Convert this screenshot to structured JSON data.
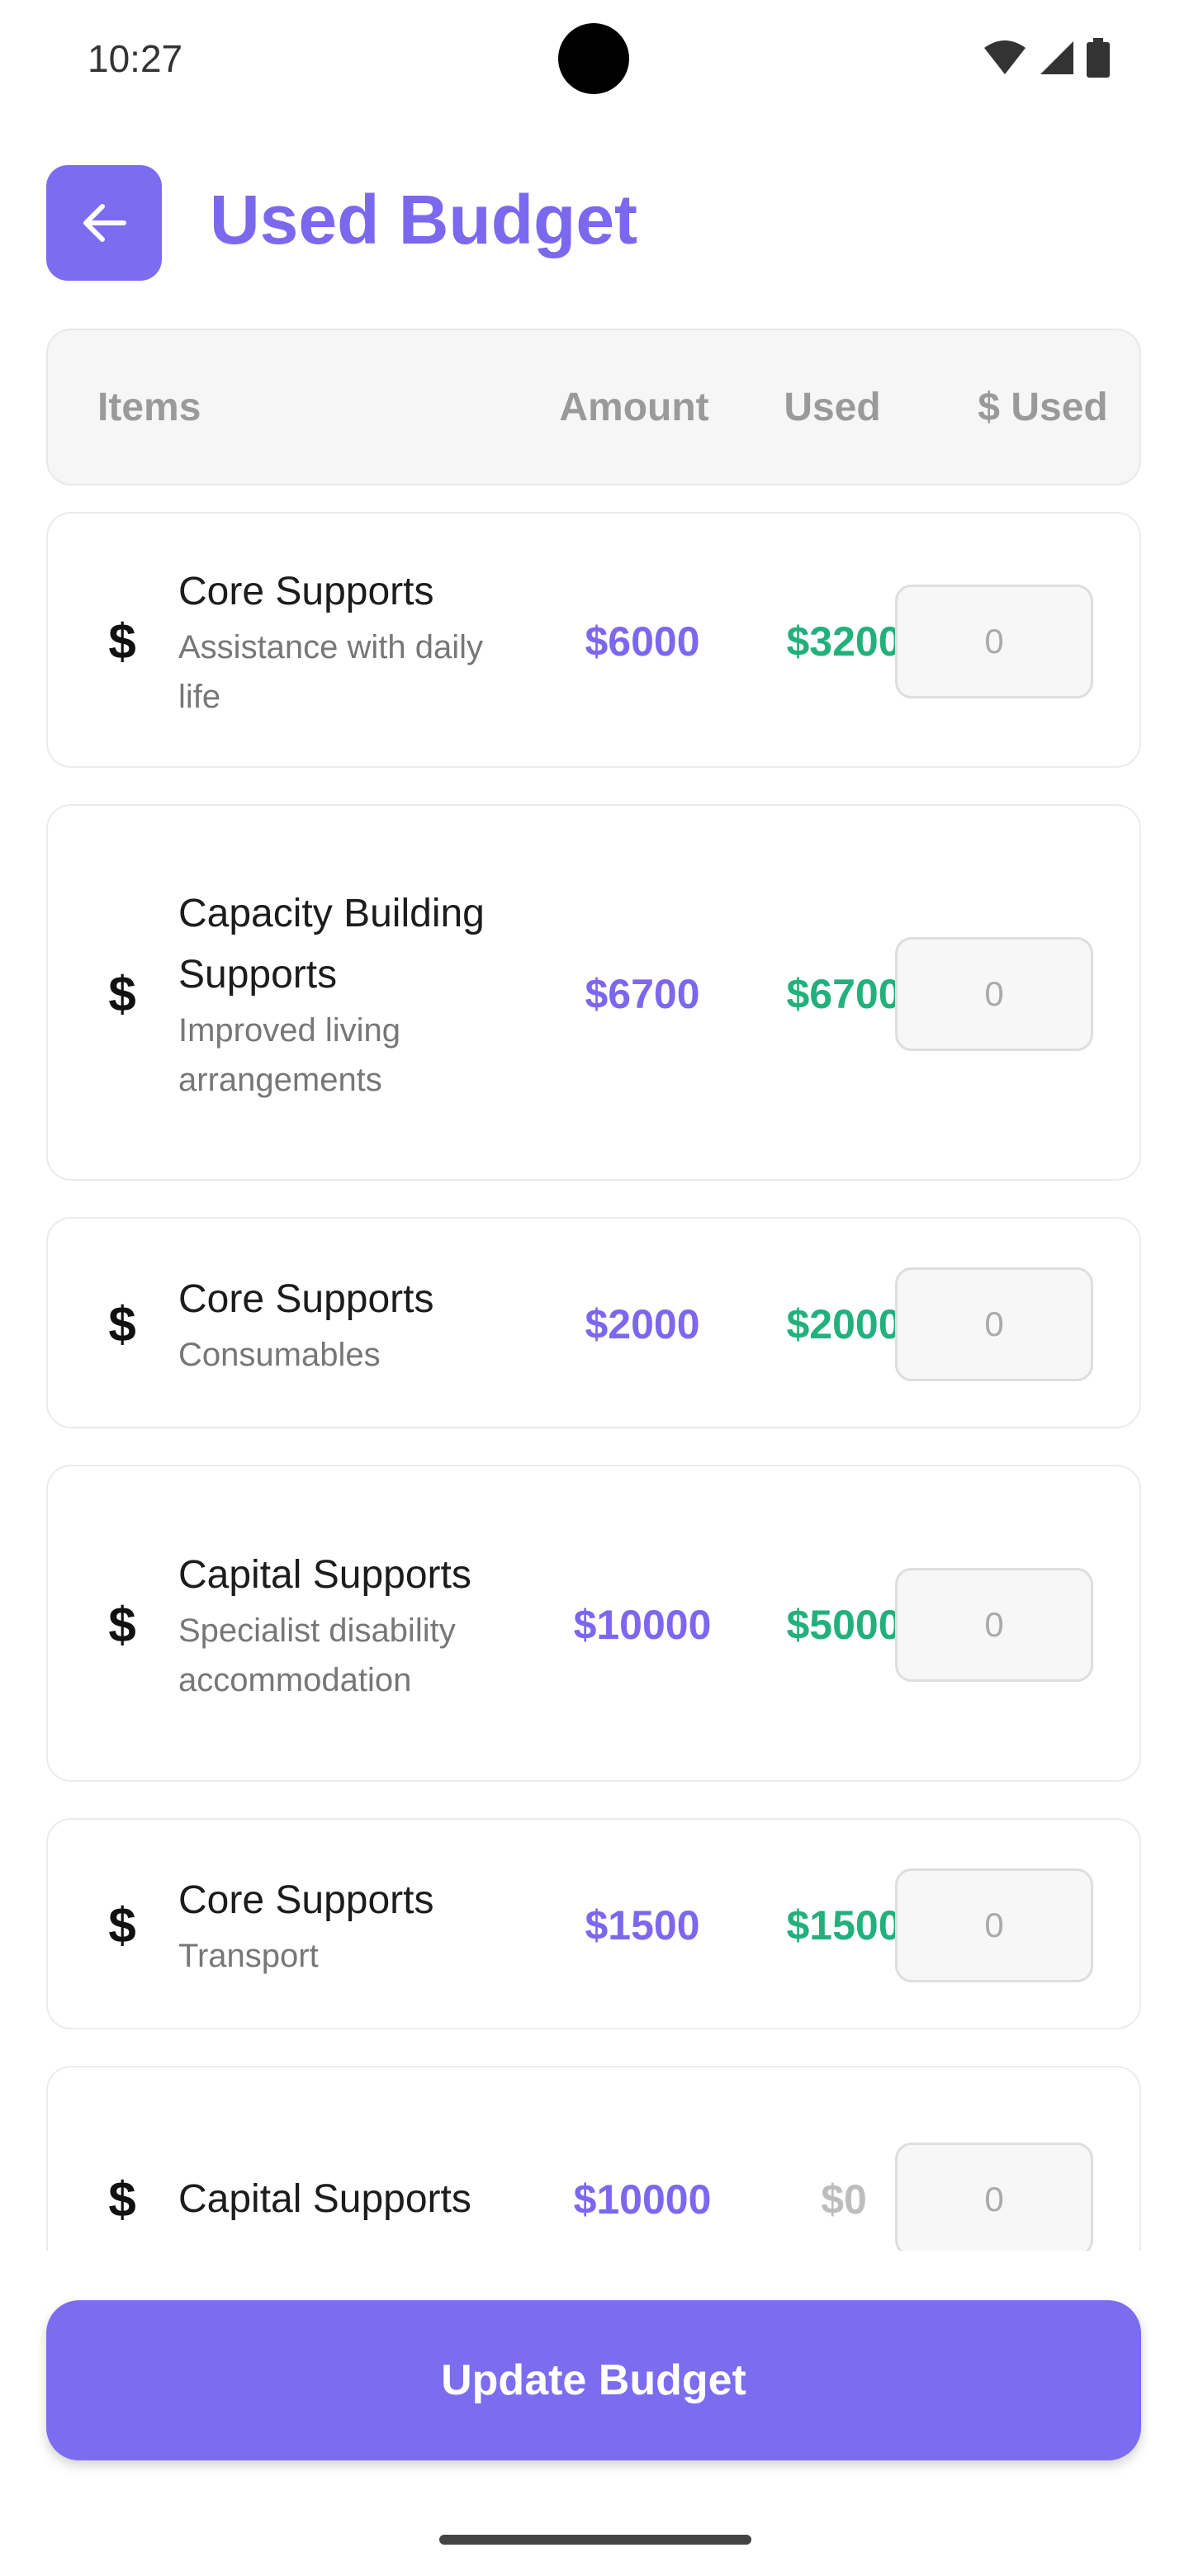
{
  "status_bar": {
    "time": "10:27",
    "icons": [
      "wifi-icon",
      "signal-icon",
      "battery-icon"
    ]
  },
  "header": {
    "back_icon": "arrow-left-icon",
    "title": "Used Budget"
  },
  "table_header": {
    "items": "Items",
    "amount": "Amount",
    "used": "Used",
    "dollar_used": "$ Used"
  },
  "budget_items": [
    {
      "icon": "$",
      "title": "Core Supports",
      "subtitle": "Assistance with daily life",
      "amount": "$6000",
      "used": "$3200",
      "input_placeholder": "0"
    },
    {
      "icon": "$",
      "title": "Capacity Building Supports",
      "subtitle": "Improved living arrangements",
      "amount": "$6700",
      "used": "$6700",
      "input_placeholder": "0"
    },
    {
      "icon": "$",
      "title": "Core Supports",
      "subtitle": "Consumables",
      "amount": "$2000",
      "used": "$2000",
      "input_placeholder": "0"
    },
    {
      "icon": "$",
      "title": "Capital Supports",
      "subtitle": "Specialist disability accommodation",
      "amount": "$10000",
      "used": "$5000",
      "input_placeholder": "0"
    },
    {
      "icon": "$",
      "title": "Core Supports",
      "subtitle": "Transport",
      "amount": "$1500",
      "used": "$1500",
      "input_placeholder": "0"
    },
    {
      "icon": "$",
      "title": "Capital Supports",
      "subtitle": "",
      "amount": "$10000",
      "used": "$0",
      "input_placeholder": "0"
    }
  ],
  "footer": {
    "update_button": "Update Budget"
  },
  "colors": {
    "accent": "#7b68ee",
    "button": "#7b6cf0",
    "used_green": "#22b07d",
    "used_zero": "#bdbdbd"
  }
}
